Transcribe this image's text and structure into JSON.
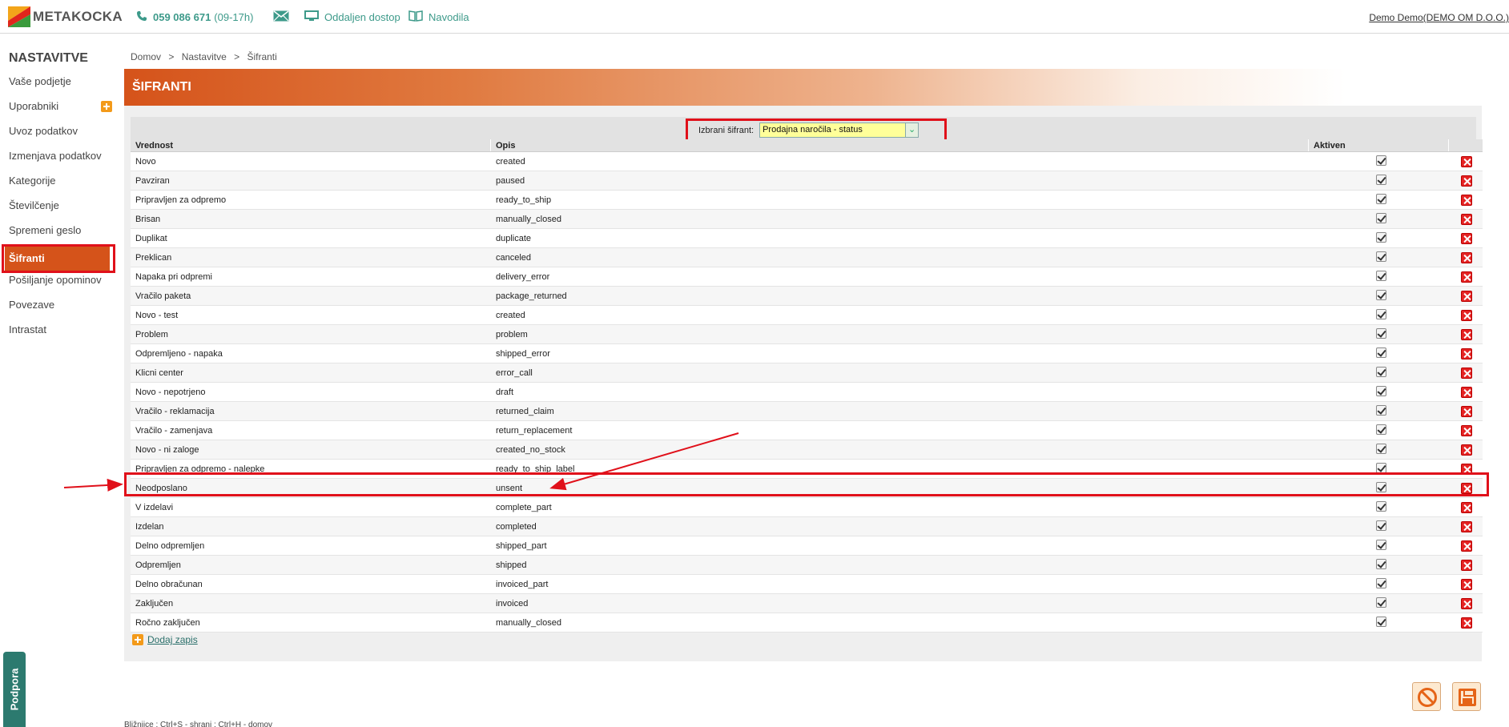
{
  "app": {
    "name": "METAKOCKA"
  },
  "header": {
    "phone_number": "059 086 671",
    "phone_hours": "(09-17h)",
    "remote_label": "Oddaljen dostop",
    "manuals_label": "Navodila",
    "user_label": "Demo Demo(DEMO OM D.O.O.)"
  },
  "sidebar": {
    "title": "NASTAVITVE",
    "items": [
      {
        "label": "Vaše podjetje"
      },
      {
        "label": "Uporabniki"
      },
      {
        "label": "Uvoz podatkov"
      },
      {
        "label": "Izmenjava podatkov"
      },
      {
        "label": "Kategorije"
      },
      {
        "label": "Številčenje"
      },
      {
        "label": "Spremeni geslo"
      },
      {
        "label": "Šifranti"
      },
      {
        "label": "Pošiljanje opominov"
      },
      {
        "label": "Povezave"
      },
      {
        "label": "Intrastat"
      }
    ],
    "active_index": 7
  },
  "breadcrumb": [
    "Domov",
    ">",
    "Nastavitve",
    ">",
    "Šifranti"
  ],
  "page_title": "ŠIFRANTI",
  "selector": {
    "label": "Izbrani šifrant:",
    "value": "Prodajna naročila - status"
  },
  "table": {
    "headers": {
      "value": "Vrednost",
      "description": "Opis",
      "active": "Aktiven"
    },
    "rows": [
      {
        "value": "Novo",
        "description": "created"
      },
      {
        "value": "Pavziran",
        "description": "paused"
      },
      {
        "value": "Pripravljen za odpremo",
        "description": "ready_to_ship"
      },
      {
        "value": "Brisan",
        "description": "manually_closed"
      },
      {
        "value": "Duplikat",
        "description": "duplicate"
      },
      {
        "value": "Preklican",
        "description": "canceled"
      },
      {
        "value": "Napaka pri odpremi",
        "description": "delivery_error"
      },
      {
        "value": "Vračilo paketa",
        "description": "package_returned"
      },
      {
        "value": "Novo - test",
        "description": "created"
      },
      {
        "value": "Problem",
        "description": "problem"
      },
      {
        "value": "Odpremljeno - napaka",
        "description": "shipped_error"
      },
      {
        "value": "Klicni center",
        "description": "error_call"
      },
      {
        "value": "Novo - nepotrjeno",
        "description": "draft"
      },
      {
        "value": "Vračilo - reklamacija",
        "description": "returned_claim"
      },
      {
        "value": "Vračilo - zamenjava",
        "description": "return_replacement"
      },
      {
        "value": "Novo - ni zaloge",
        "description": "created_no_stock"
      },
      {
        "value": "Pripravljen za odpremo - nalepke",
        "description": "ready_to_ship_label"
      },
      {
        "value": "Neodposlano",
        "description": "unsent"
      },
      {
        "value": "V izdelavi",
        "description": "complete_part"
      },
      {
        "value": "Izdelan",
        "description": "completed"
      },
      {
        "value": "Delno odpremljen",
        "description": "shipped_part"
      },
      {
        "value": "Odpremljen",
        "description": "shipped"
      },
      {
        "value": "Delno obračunan",
        "description": "invoiced_part"
      },
      {
        "value": "Zaključen",
        "description": "invoiced"
      },
      {
        "value": "Ročno zaključen",
        "description": "manually_closed"
      }
    ]
  },
  "add_record_label": "Dodaj zapis",
  "shortcuts_text": "Bližnjice : Ctrl+S - shrani ; Ctrl+H - domov",
  "support_label": "Podpora",
  "colors": {
    "brand_orange": "#d5531a",
    "teal": "#3d9a8a",
    "highlight_red": "#e0101a"
  }
}
